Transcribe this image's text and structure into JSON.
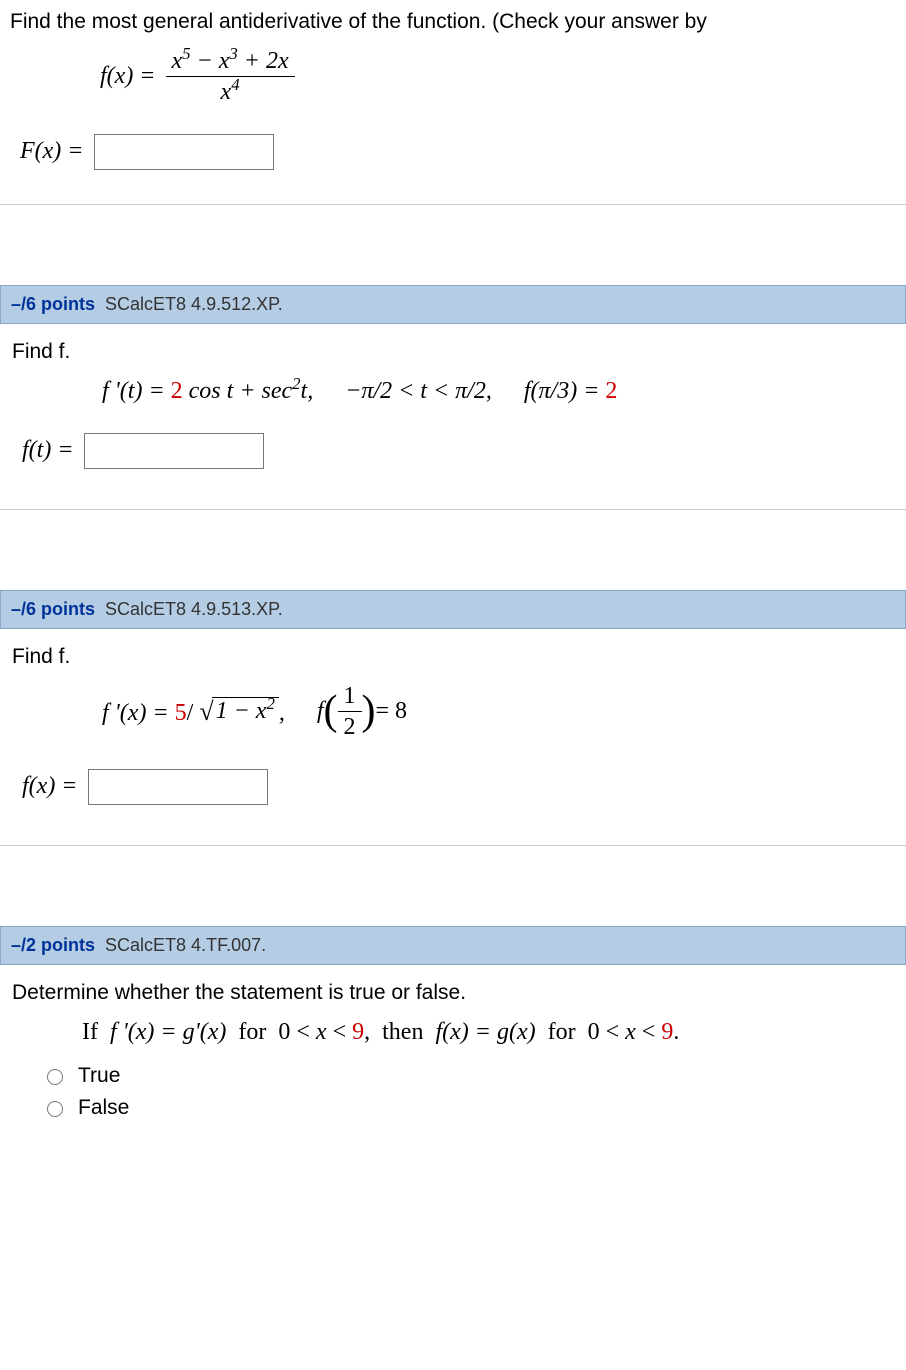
{
  "q1": {
    "prompt": "Find the most general antiderivative of the function. (Check your answer by",
    "func_lhs": "f(x) = ",
    "num": "x",
    "num_e1": "5",
    "num_m": " − x",
    "num_e2": "3",
    "num_r": " + 2x",
    "den": "x",
    "den_e": "4",
    "ans_label": "F(x) = "
  },
  "q2": {
    "points": "–/6 points",
    "ref": "SCalcET8 4.9.512.XP.",
    "prompt": "Find f.",
    "expr_a": "f '(t) = ",
    "expr_b": "2",
    "expr_c": " cos t + sec",
    "expr_d": "2",
    "expr_e": "t,",
    "cond": "−π/2 < t < π/2,",
    "init": "f(π/3) = ",
    "init_v": "2",
    "ans_label": "f(t) = "
  },
  "q3": {
    "points": "–/6 points",
    "ref": "SCalcET8 4.9.513.XP.",
    "prompt": "Find f.",
    "expr_a": "f '(x) = ",
    "coef": "5",
    "slash": "/",
    "sqrt_body_a": "1 − x",
    "sqrt_body_e": "2",
    "comma": ",",
    "f_of": "f",
    "half_num": "1",
    "half_den": "2",
    "eq8": " = 8",
    "ans_label": "f(x) = "
  },
  "q4": {
    "points": "–/2 points",
    "ref": "SCalcET8 4.TF.007.",
    "prompt": "Determine whether the statement is true or false.",
    "stmt_a": "If  f '(x) = g'(x)  for  0 < x < ",
    "stmt_b": "9",
    "stmt_c": ",  then  f(x) = g(x)  for  0 < x < ",
    "stmt_d": "9",
    "stmt_e": ".",
    "opt_true": "True",
    "opt_false": "False"
  }
}
